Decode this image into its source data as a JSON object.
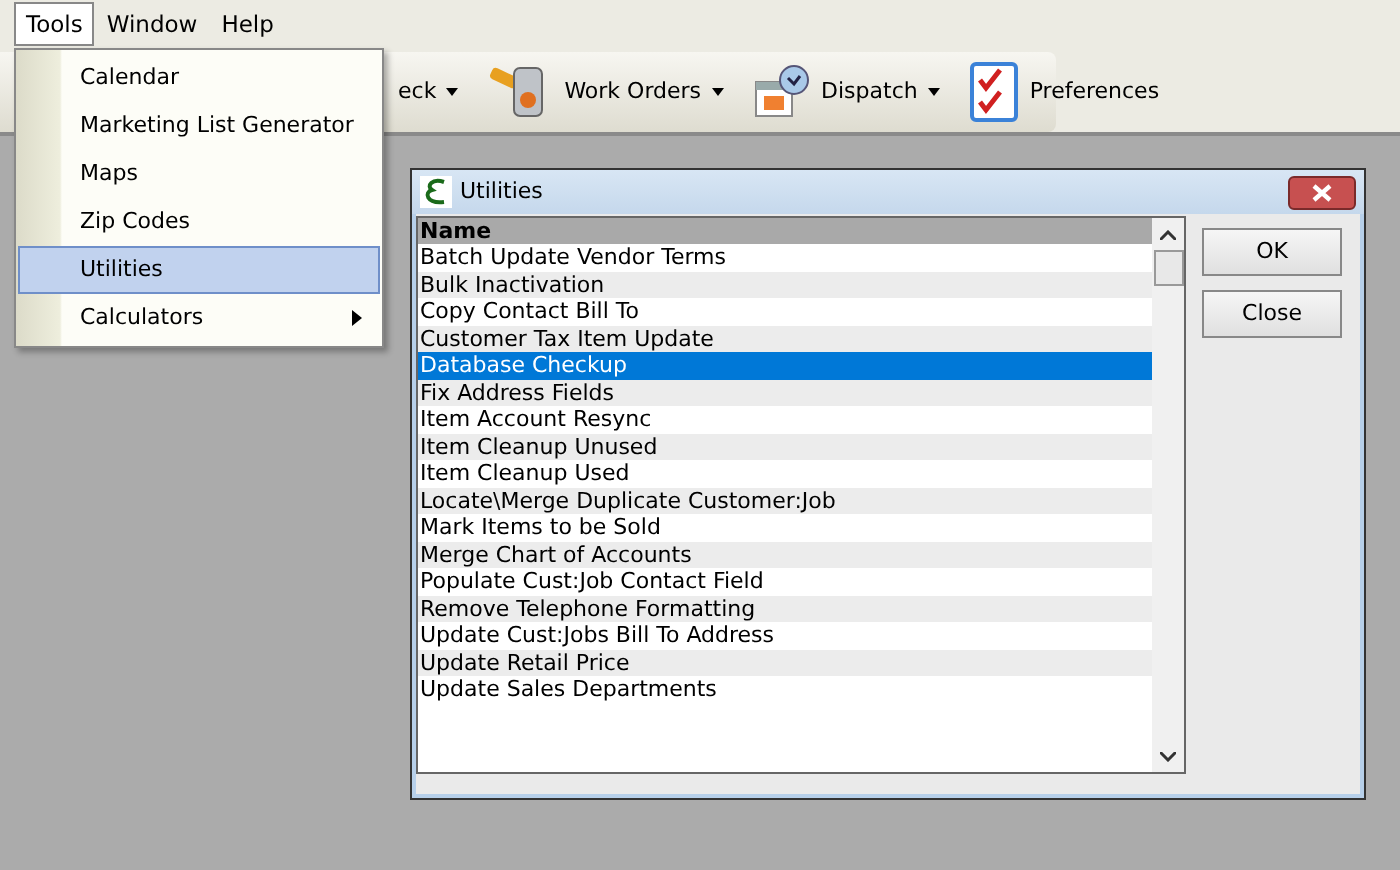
{
  "menubar": [
    {
      "label": "Tools",
      "selected": true
    },
    {
      "label": "Window",
      "selected": false
    },
    {
      "label": "Help",
      "selected": false
    }
  ],
  "toolbar": [
    {
      "label": "eck",
      "kind": "cut",
      "dropdown": true
    },
    {
      "label": "Work Orders",
      "kind": "workorders",
      "dropdown": true
    },
    {
      "label": "Dispatch",
      "kind": "dispatch",
      "dropdown": true
    },
    {
      "label": "Preferences",
      "kind": "preferences",
      "dropdown": false
    }
  ],
  "tools_menu": [
    {
      "label": "Calendar",
      "selected": false,
      "submenu": false
    },
    {
      "label": "Marketing List Generator",
      "selected": false,
      "submenu": false
    },
    {
      "label": "Maps",
      "selected": false,
      "submenu": false
    },
    {
      "label": "Zip Codes",
      "selected": false,
      "submenu": false
    },
    {
      "label": "Utilities",
      "selected": true,
      "submenu": false
    },
    {
      "label": "Calculators",
      "selected": false,
      "submenu": true
    }
  ],
  "dialog": {
    "title": "Utilities",
    "column": "Name",
    "rows": [
      {
        "name": "Batch Update Vendor Terms",
        "selected": false
      },
      {
        "name": "Bulk Inactivation",
        "selected": false
      },
      {
        "name": "Copy Contact Bill To",
        "selected": false
      },
      {
        "name": "Customer Tax Item Update",
        "selected": false
      },
      {
        "name": "Database Checkup",
        "selected": true
      },
      {
        "name": "Fix Address Fields",
        "selected": false
      },
      {
        "name": "Item Account Resync",
        "selected": false
      },
      {
        "name": "Item Cleanup Unused",
        "selected": false
      },
      {
        "name": "Item Cleanup Used",
        "selected": false
      },
      {
        "name": "Locate\\Merge Duplicate Customer:Job",
        "selected": false
      },
      {
        "name": "Mark Items to be Sold",
        "selected": false
      },
      {
        "name": "Merge Chart of Accounts",
        "selected": false
      },
      {
        "name": "Populate Cust:Job Contact Field",
        "selected": false
      },
      {
        "name": "Remove Telephone Formatting",
        "selected": false
      },
      {
        "name": "Update Cust:Jobs Bill To Address",
        "selected": false
      },
      {
        "name": "Update Retail Price",
        "selected": false
      },
      {
        "name": "Update Sales Departments",
        "selected": false
      }
    ],
    "buttons": [
      "OK",
      "Close"
    ]
  }
}
